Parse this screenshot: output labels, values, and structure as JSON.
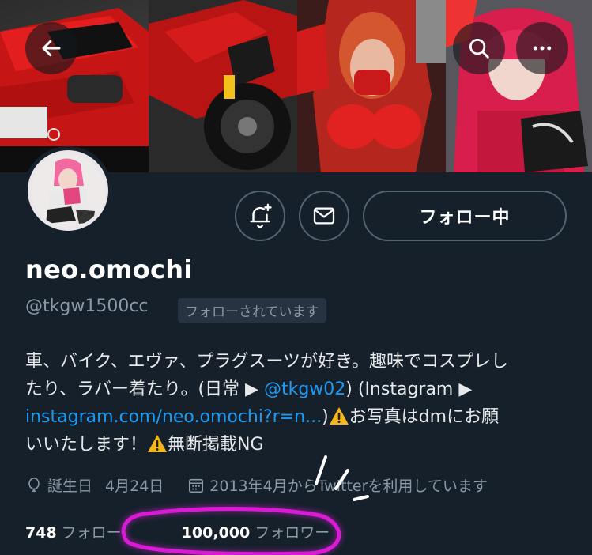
{
  "header": {
    "back_icon": "arrow-left-icon",
    "search_icon": "search-icon",
    "more_icon": "more-horizontal-icon"
  },
  "actions": {
    "notify_icon": "bell-plus-icon",
    "dm_icon": "mail-icon",
    "follow_label": "フォロー中"
  },
  "profile": {
    "display_name": "neo.omochi",
    "handle": "@tkgw1500cc",
    "follows_you_badge": "フォローされています",
    "bio": {
      "line1": "車、バイク、エヴァ、プラグスーツが好き。趣味でコスプレし",
      "line2_a": "たり、ラバー着たり。(日常 ▶ ",
      "line2_link": "@tkgw02",
      "line2_b": ") (Instagram ▶",
      "line3_link": "instagram.com/neo.omochi?r=n...",
      "line3_b": ")",
      "line3_c": "お写真はdmにお願",
      "line4_a": "いいたします！",
      "line4_b": "無断掲載NG"
    },
    "birthday_label": "誕生日",
    "birthday_value": "4月24日",
    "joined_text": "2013年4月からTwitterを利用しています",
    "following_count": "748",
    "following_label": "フォロー",
    "followers_count": "100,000",
    "followers_label": "フォロワー"
  },
  "colors": {
    "background": "#15202b",
    "link": "#1d9bf0",
    "secondary_text": "#8b98a5",
    "annotation": "#d91bd6"
  }
}
